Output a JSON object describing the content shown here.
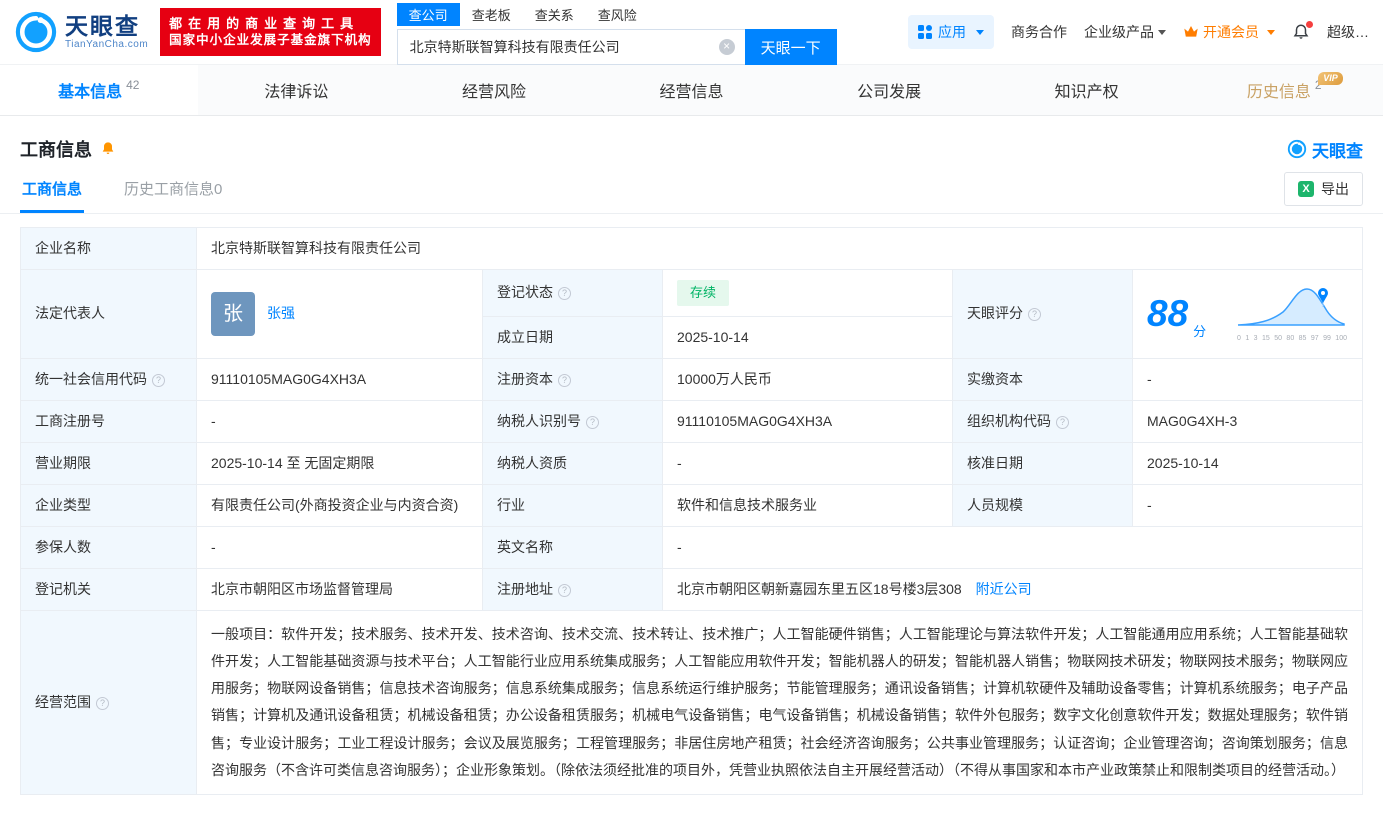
{
  "colors": {
    "brand_blue": "#0084ff",
    "promo_red": "#e60012",
    "vip_orange": "#ff7d00",
    "history_gold": "#c9a265",
    "status_green": "#00b365",
    "label_cell_bg": "#f1f8fe"
  },
  "icons": {
    "logo": "tianyancha-swirl",
    "search_clear": "circle-x",
    "apps": "grid-4",
    "vip": "crown",
    "notifications": "bell",
    "subscribe": "bell",
    "export": "excel",
    "help": "question-circle",
    "score_marker": "location-pin"
  },
  "brand": {
    "logo_text": "天眼查",
    "logo_domain": "TianYanCha.com",
    "promo_line1": "都在用的商业查询工具",
    "promo_line2": "国家中小企业发展子基金旗下机构"
  },
  "search": {
    "tabs": [
      {
        "label": "查公司",
        "active": true
      },
      {
        "label": "查老板",
        "active": false
      },
      {
        "label": "查关系",
        "active": false
      },
      {
        "label": "查风险",
        "active": false
      }
    ],
    "value": "北京特斯联智算科技有限责任公司",
    "button": "天眼一下"
  },
  "topnav": {
    "apps": "应用",
    "business_coop": "商务合作",
    "enterprise_products": "企业级产品",
    "open_vip": "开通会员",
    "super": "超级…"
  },
  "main_tabs": [
    {
      "label": "基本信息",
      "count": "42"
    },
    {
      "label": "法律诉讼",
      "count": ""
    },
    {
      "label": "经营风险",
      "count": ""
    },
    {
      "label": "经营信息",
      "count": ""
    },
    {
      "label": "公司发展",
      "count": ""
    },
    {
      "label": "知识产权",
      "count": ""
    },
    {
      "label": "历史信息",
      "count": "2",
      "badge": "VIP"
    }
  ],
  "section": {
    "title": "工商信息",
    "watermark": "天眼查",
    "subtabs": [
      {
        "label": "工商信息",
        "active": true
      },
      {
        "label": "历史工商信息0",
        "active": false
      }
    ],
    "export_label": "导出"
  },
  "fields": {
    "name": {
      "label": "企业名称",
      "value": "北京特斯联智算科技有限责任公司"
    },
    "legal_rep": {
      "label": "法定代表人",
      "avatar": "张",
      "name": "张强"
    },
    "status": {
      "label": "登记状态",
      "value": "存续"
    },
    "established": {
      "label": "成立日期",
      "value": "2025-10-14"
    },
    "score": {
      "label": "天眼评分",
      "value": "88",
      "unit": "分",
      "axis_ticks": [
        "0",
        "1",
        "3",
        "15",
        "50",
        "80",
        "85",
        "97",
        "99",
        "100"
      ]
    },
    "credit_code": {
      "label": "统一社会信用代码",
      "value": "91110105MAG0G4XH3A"
    },
    "reg_capital": {
      "label": "注册资本",
      "value": "10000万人民币"
    },
    "paid_capital": {
      "label": "实缴资本",
      "value": "-"
    },
    "reg_no": {
      "label": "工商注册号",
      "value": "-"
    },
    "taxpayer_no": {
      "label": "纳税人识别号",
      "value": "91110105MAG0G4XH3A"
    },
    "org_code": {
      "label": "组织机构代码",
      "value": "MAG0G4XH-3"
    },
    "term": {
      "label": "营业期限",
      "value": "2025-10-14 至 无固定期限"
    },
    "taxpayer_qualification": {
      "label": "纳税人资质",
      "value": "-"
    },
    "approved_date": {
      "label": "核准日期",
      "value": "2025-10-14"
    },
    "company_type": {
      "label": "企业类型",
      "value": "有限责任公司(外商投资企业与内资合资)"
    },
    "industry": {
      "label": "行业",
      "value": "软件和信息技术服务业"
    },
    "staff_size": {
      "label": "人员规模",
      "value": "-"
    },
    "insured_count": {
      "label": "参保人数",
      "value": "-"
    },
    "english_name": {
      "label": "英文名称",
      "value": "-"
    },
    "registry": {
      "label": "登记机关",
      "value": "北京市朝阳区市场监督管理局"
    },
    "address": {
      "label": "注册地址",
      "value": "北京市朝阳区朝新嘉园东里五区18号楼3层308",
      "nearby_link": "附近公司"
    },
    "scope": {
      "label": "经营范围",
      "value": "一般项目：软件开发；技术服务、技术开发、技术咨询、技术交流、技术转让、技术推广；人工智能硬件销售；人工智能理论与算法软件开发；人工智能通用应用系统；人工智能基础软件开发；人工智能基础资源与技术平台；人工智能行业应用系统集成服务；人工智能应用软件开发；智能机器人的研发；智能机器人销售；物联网技术研发；物联网技术服务；物联网应用服务；物联网设备销售；信息技术咨询服务；信息系统集成服务；信息系统运行维护服务；节能管理服务；通讯设备销售；计算机软硬件及辅助设备零售；计算机系统服务；电子产品销售；计算机及通讯设备租赁；机械设备租赁；办公设备租赁服务；机械电气设备销售；电气设备销售；机械设备销售；软件外包服务；数字文化创意软件开发；数据处理服务；软件销售；专业设计服务；工业工程设计服务；会议及展览服务；工程管理服务；非居住房地产租赁；社会经济咨询服务；公共事业管理服务；认证咨询；企业管理咨询；咨询策划服务；信息咨询服务（不含许可类信息咨询服务）；企业形象策划。（除依法须经批准的项目外，凭营业执照依法自主开展经营活动）（不得从事国家和本市产业政策禁止和限制类项目的经营活动。）"
    }
  }
}
